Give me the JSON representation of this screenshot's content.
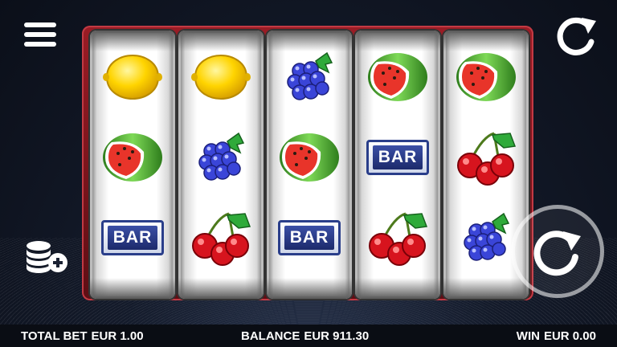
{
  "reels": [
    [
      "lemon",
      "watermelon",
      "bar"
    ],
    [
      "lemon",
      "blackberry",
      "cherries"
    ],
    [
      "blackberry",
      "watermelon",
      "bar"
    ],
    [
      "watermelon",
      "bar",
      "cherries"
    ],
    [
      "watermelon",
      "cherries",
      "blackberry"
    ]
  ],
  "bar_symbol_text": "BAR",
  "status": {
    "total_bet_label": "TOTAL BET",
    "total_bet_value": "EUR 1.00",
    "balance_label": "BALANCE",
    "balance_value": "EUR 911.30",
    "win_label": "WIN",
    "win_value": "EUR 0.00"
  },
  "icons": {
    "menu": "menu-icon",
    "refresh": "autoplay-icon",
    "bet": "coin-stack-plus-icon",
    "spin": "spin-icon"
  },
  "colors": {
    "frame": "#9a1c25",
    "bar_blue": "#2a3e8a",
    "background": "#141b2b"
  }
}
